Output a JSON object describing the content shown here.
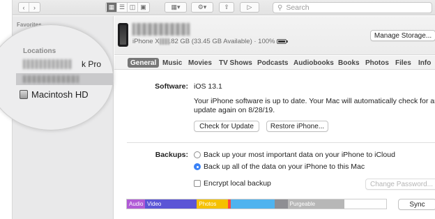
{
  "toolbar": {
    "back_icon": "chevron-left-icon",
    "forward_icon": "chevron-right-icon",
    "search_placeholder": "Search"
  },
  "sidebar": {
    "favorites_label": "Favorites",
    "locations_label": "Locations",
    "device_label_partial": "k Pro",
    "macintosh_label": "Macintosh HD"
  },
  "device": {
    "info_prefix": "iPhone X",
    "info_suffix": ".82 GB (33.45 GB Available) · 100%",
    "manage_storage": "Manage Storage..."
  },
  "tabs": [
    "General",
    "Music",
    "Movies",
    "TV Shows",
    "Podcasts",
    "Audiobooks",
    "Books",
    "Photos",
    "Files",
    "Info"
  ],
  "software": {
    "label": "Software:",
    "version": "iOS 13.1",
    "message_line1": "Your iPhone software is up to date. Your Mac will automatically check for an",
    "message_line2": "update again on 8/28/19.",
    "check_button": "Check for Update",
    "restore_button": "Restore iPhone..."
  },
  "backups": {
    "label": "Backups:",
    "option_icloud": "Back up your most important data on your iPhone to iCloud",
    "option_mac": "Back up all of the data on your iPhone to this Mac",
    "selected": "mac",
    "encrypt_label": "Encrypt local backup",
    "encrypt_checked": false,
    "change_password": "Change Password..."
  },
  "storage_bar": {
    "segments": [
      {
        "label": "Audio",
        "color": "#b05ad6",
        "fraction": 0.07
      },
      {
        "label": "Video",
        "color": "#5b55d6",
        "fraction": 0.2
      },
      {
        "label": "Photos",
        "color": "#f5c100",
        "fraction": 0.12
      },
      {
        "label": "",
        "color": "#ff4a3d",
        "fraction": 0.01
      },
      {
        "label": "",
        "color": "#4fb3ef",
        "fraction": 0.17
      },
      {
        "label": "",
        "color": "#8e8e93",
        "fraction": 0.05
      },
      {
        "label": "Purgeable",
        "color": "#b7b7b7",
        "fraction": 0.22
      },
      {
        "label": "",
        "color": "#ffffff",
        "fraction": 0.16
      }
    ]
  },
  "sync_button": "Sync"
}
